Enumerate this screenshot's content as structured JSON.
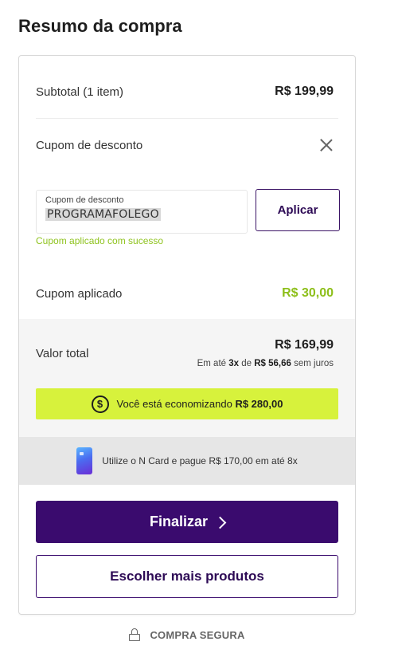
{
  "page": {
    "title": "Resumo da compra"
  },
  "summary": {
    "subtotal_label": "Subtotal (1 item)",
    "subtotal_value": "R$ 199,99",
    "coupon_toggle_label": "Cupom de desconto"
  },
  "coupon": {
    "field_label": "Cupom de desconto",
    "field_value": "PROGRAMAFOLEGO",
    "apply_label": "Aplicar",
    "success_message": "Cupom aplicado com sucesso",
    "applied_label": "Cupom aplicado",
    "applied_value": "R$ 30,00"
  },
  "total": {
    "label": "Valor total",
    "value": "R$ 169,99",
    "installment_prefix": "Em até",
    "installment_count": "3x",
    "installment_mid": "de",
    "installment_amount": "R$ 56,66",
    "installment_suffix": "sem juros"
  },
  "saving": {
    "text": "Você está economizando",
    "amount": "R$ 280,00",
    "icon": "dollar-circle-icon"
  },
  "ncard": {
    "text": "Utilize o N Card e pague R$ 170,00 em até 8x",
    "icon": "ncard-icon"
  },
  "actions": {
    "finalize_label": "Finalizar",
    "more_products_label": "Escolher mais produtos"
  },
  "footer": {
    "secure_label": "COMPRA SEGURA",
    "icon": "lock-icon"
  },
  "colors": {
    "primary": "#3a0b6e",
    "accent_green": "#8dbf1a",
    "saving_bg": "#d7f23c"
  }
}
